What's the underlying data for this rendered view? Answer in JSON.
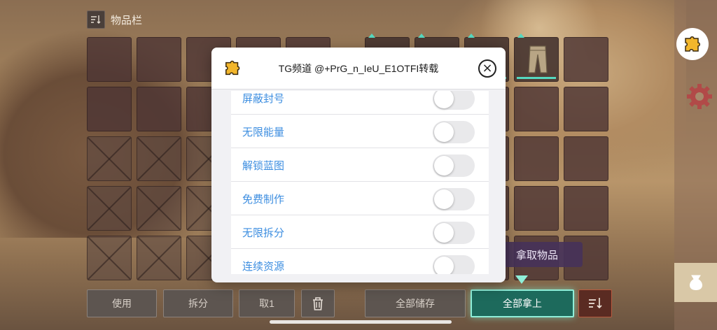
{
  "inventory": {
    "title": "物品栏",
    "sort_icon": "sort-icon"
  },
  "buttons": {
    "use": "使用",
    "split": "拆分",
    "take_one": "取1",
    "trash_icon": "trash-icon",
    "store_all": "全部储存",
    "take_all": "全部拿上",
    "sort_icon": "sort-icon"
  },
  "take_items_tag": "拿取物品",
  "modal": {
    "title": "TG频道 @+PrG_n_IeU_E1OTFI转载",
    "close_icon": "close-icon",
    "logo_icon": "puzzle-logo-icon",
    "items": [
      {
        "label": "屏蔽封号",
        "enabled": false
      },
      {
        "label": "无限能量",
        "enabled": false
      },
      {
        "label": "解锁蓝图",
        "enabled": false
      },
      {
        "label": "免费制作",
        "enabled": false
      },
      {
        "label": "无限拆分",
        "enabled": false
      },
      {
        "label": "连续资源",
        "enabled": false
      }
    ]
  },
  "sidebar": {
    "items": [
      {
        "icon": "puzzle-icon",
        "active": true
      },
      {
        "icon": "gear-icon",
        "active": false
      },
      {
        "icon": "bag-icon",
        "active": false
      }
    ]
  },
  "colors": {
    "accent": "#55d8c0",
    "link_blue": "#3d8ee0",
    "sort_red": "#5a2b22"
  }
}
